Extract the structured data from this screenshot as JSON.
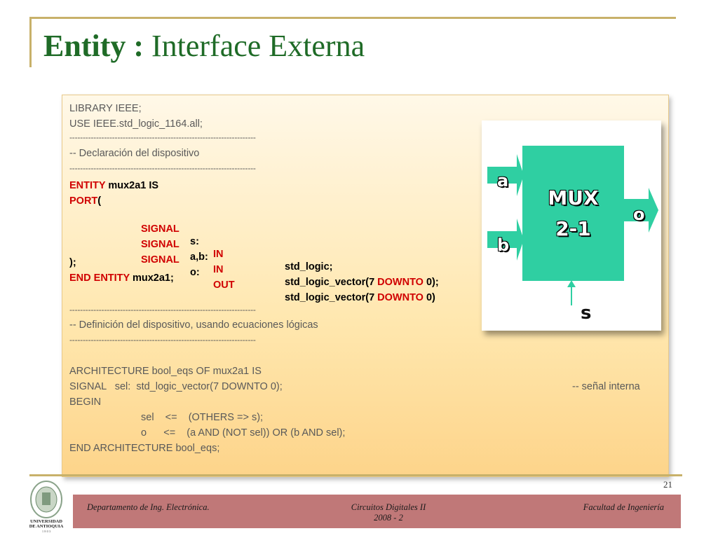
{
  "slide": {
    "title_bold": "Entity :",
    "title_rest": " Interface Externa",
    "page_number": "21"
  },
  "code": {
    "l1": "LIBRARY IEEE;",
    "l2": "USE IEEE.std_logic_1164.all;",
    "sep1": "----------------------------------------------------------------------",
    "l3": "-- Declaración del dispositivo",
    "sep2": "----------------------------------------------------------------------",
    "entity_kw": "ENTITY",
    "entity_rest": " mux2a1 IS",
    "port_kw": "PORT",
    "port_paren": "(",
    "signal_kw": "SIGNAL",
    "sig1_name": "s:",
    "sig1_mode": "IN",
    "sig1_type": "std_logic;",
    "sig2_name": "a,b:",
    "sig2_mode": "IN",
    "sig2_type_a": "std_logic_vector(7 ",
    "downto_kw": "DOWNTO",
    "sig2_type_b": " 0);",
    "sig3_name": "o:",
    "sig3_mode": "OUT",
    "sig3_type_a": "std_logic_vector(7 ",
    "sig3_type_b": " 0)",
    "close_paren": ");",
    "end_entity_kw": "END ENTITY",
    "end_entity_rest": " mux2a1;",
    "sep3": "----------------------------------------------------------------------",
    "l4": "-- Definición del dispositivo, usando ecuaciones lógicas",
    "sep4": "----------------------------------------------------------------------",
    "arch1": "ARCHITECTURE bool_eqs OF mux2a1 IS",
    "arch2": "SIGNAL   sel:  std_logic_vector(7 DOWNTO 0);",
    "arch2_comment": "-- señal interna",
    "arch3": "BEGIN",
    "arch4": "sel    <=    (OTHERS => s);",
    "arch5": "o      <=    (a AND (NOT sel)) OR (b AND sel);",
    "arch6": "END ARCHITECTURE bool_eqs;"
  },
  "diagram": {
    "label_top": "MUX",
    "label_bottom": "2-1",
    "input_a": "a",
    "input_b": "b",
    "output_o": "o",
    "select_s": "s",
    "block_color": "#2fcfa2"
  },
  "footer": {
    "left": "Departamento de Ing. Electrónica.",
    "center_line1": "Circuitos Digitales II",
    "center_line2": "2008 - 2",
    "right": "Facultad de Ingeniería",
    "bar_color": "#c07878"
  },
  "logo": {
    "line1": "UNIVERSIDAD",
    "line2": "DE ANTIOQUIA",
    "line3": "1 8 0 3"
  }
}
